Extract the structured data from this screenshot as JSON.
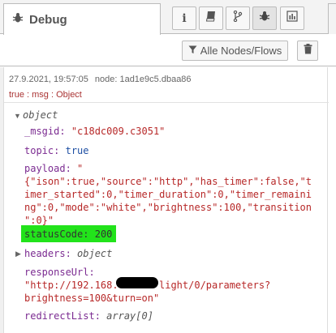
{
  "header": {
    "tab_title": "Debug",
    "icons": [
      "bug-icon",
      "info-icon",
      "book-icon",
      "branch-icon",
      "bug-icon",
      "chart-icon"
    ]
  },
  "toolbar": {
    "filter_label": "Alle Nodes/Flows"
  },
  "message": {
    "timestamp": "27.9.2021, 19:57:05",
    "node": "node: 1ad1e9c5.dbaa86",
    "path": "true : msg : Object",
    "root_label": "object",
    "fields": {
      "msgid_key": "_msgid:",
      "msgid_value": "\"c18dc009.c3051\"",
      "topic_key": "topic:",
      "topic_value": "true",
      "payload_key": "payload:",
      "payload_open": "\"",
      "payload_lines": [
        "{\"ison\":true,\"source\":\"http\",\"has_timer\":false,\"t",
        "imer_started\":0,\"timer_duration\":0,\"timer_remaini",
        "ng\":0,\"mode\":\"white\",\"brightness\":100,\"transition",
        "\":0}\""
      ],
      "status_key": "statusCode:",
      "status_value": "200",
      "headers_key": "headers:",
      "headers_value": "object",
      "response_key": "responseUrl:",
      "response_prefix": "\"http://192.168.",
      "response_suffix": "light/0/parameters?",
      "response_line2": "brightness=100&turn=on\"",
      "redirect_key": "redirectList:",
      "redirect_value": "array[0]"
    }
  }
}
